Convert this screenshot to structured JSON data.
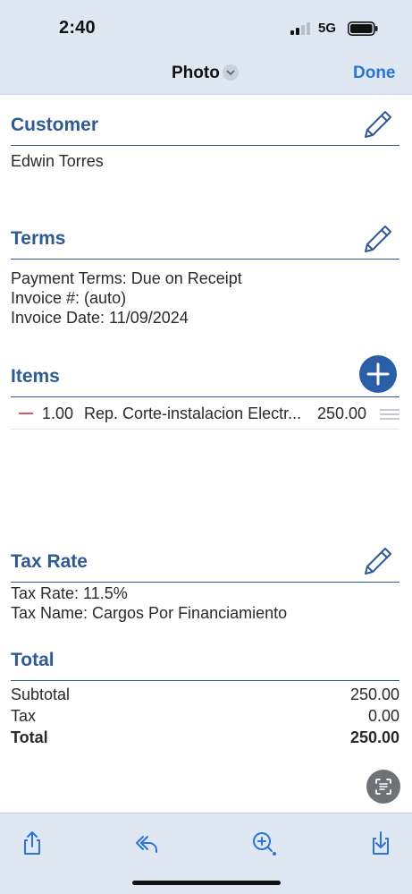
{
  "status_bar": {
    "time": "2:40",
    "network": "5G"
  },
  "nav": {
    "title": "Photo",
    "done_label": "Done"
  },
  "customer": {
    "title": "Customer",
    "name": "Edwin Torres"
  },
  "terms": {
    "title": "Terms",
    "payment_terms": "Payment Terms:  Due on Receipt",
    "invoice_number": "Invoice #:  (auto)",
    "invoice_date": "Invoice Date:  11/09/2024"
  },
  "items": {
    "title": "Items",
    "rows": [
      {
        "qty": "1.00",
        "description": "Rep. Corte-instalacion Electr...",
        "amount": "250.00"
      }
    ]
  },
  "tax": {
    "title": "Tax Rate",
    "rate_line": "Tax Rate: 11.5%",
    "name_line": "Tax Name: Cargos Por Financiamiento"
  },
  "total": {
    "title": "Total",
    "subtotal_label": "Subtotal",
    "subtotal_value": "250.00",
    "tax_label": "Tax",
    "tax_value": "0.00",
    "total_label": "Total",
    "total_value": "250.00"
  },
  "toolbar": {
    "icons": [
      "share-icon",
      "reply-icon",
      "markup-zoom-icon",
      "save-download-icon"
    ]
  },
  "colors": {
    "accent": "#2f5a94",
    "header_bg": "#dfe7f3",
    "link": "#2c74d5",
    "remove": "#e3506a"
  }
}
